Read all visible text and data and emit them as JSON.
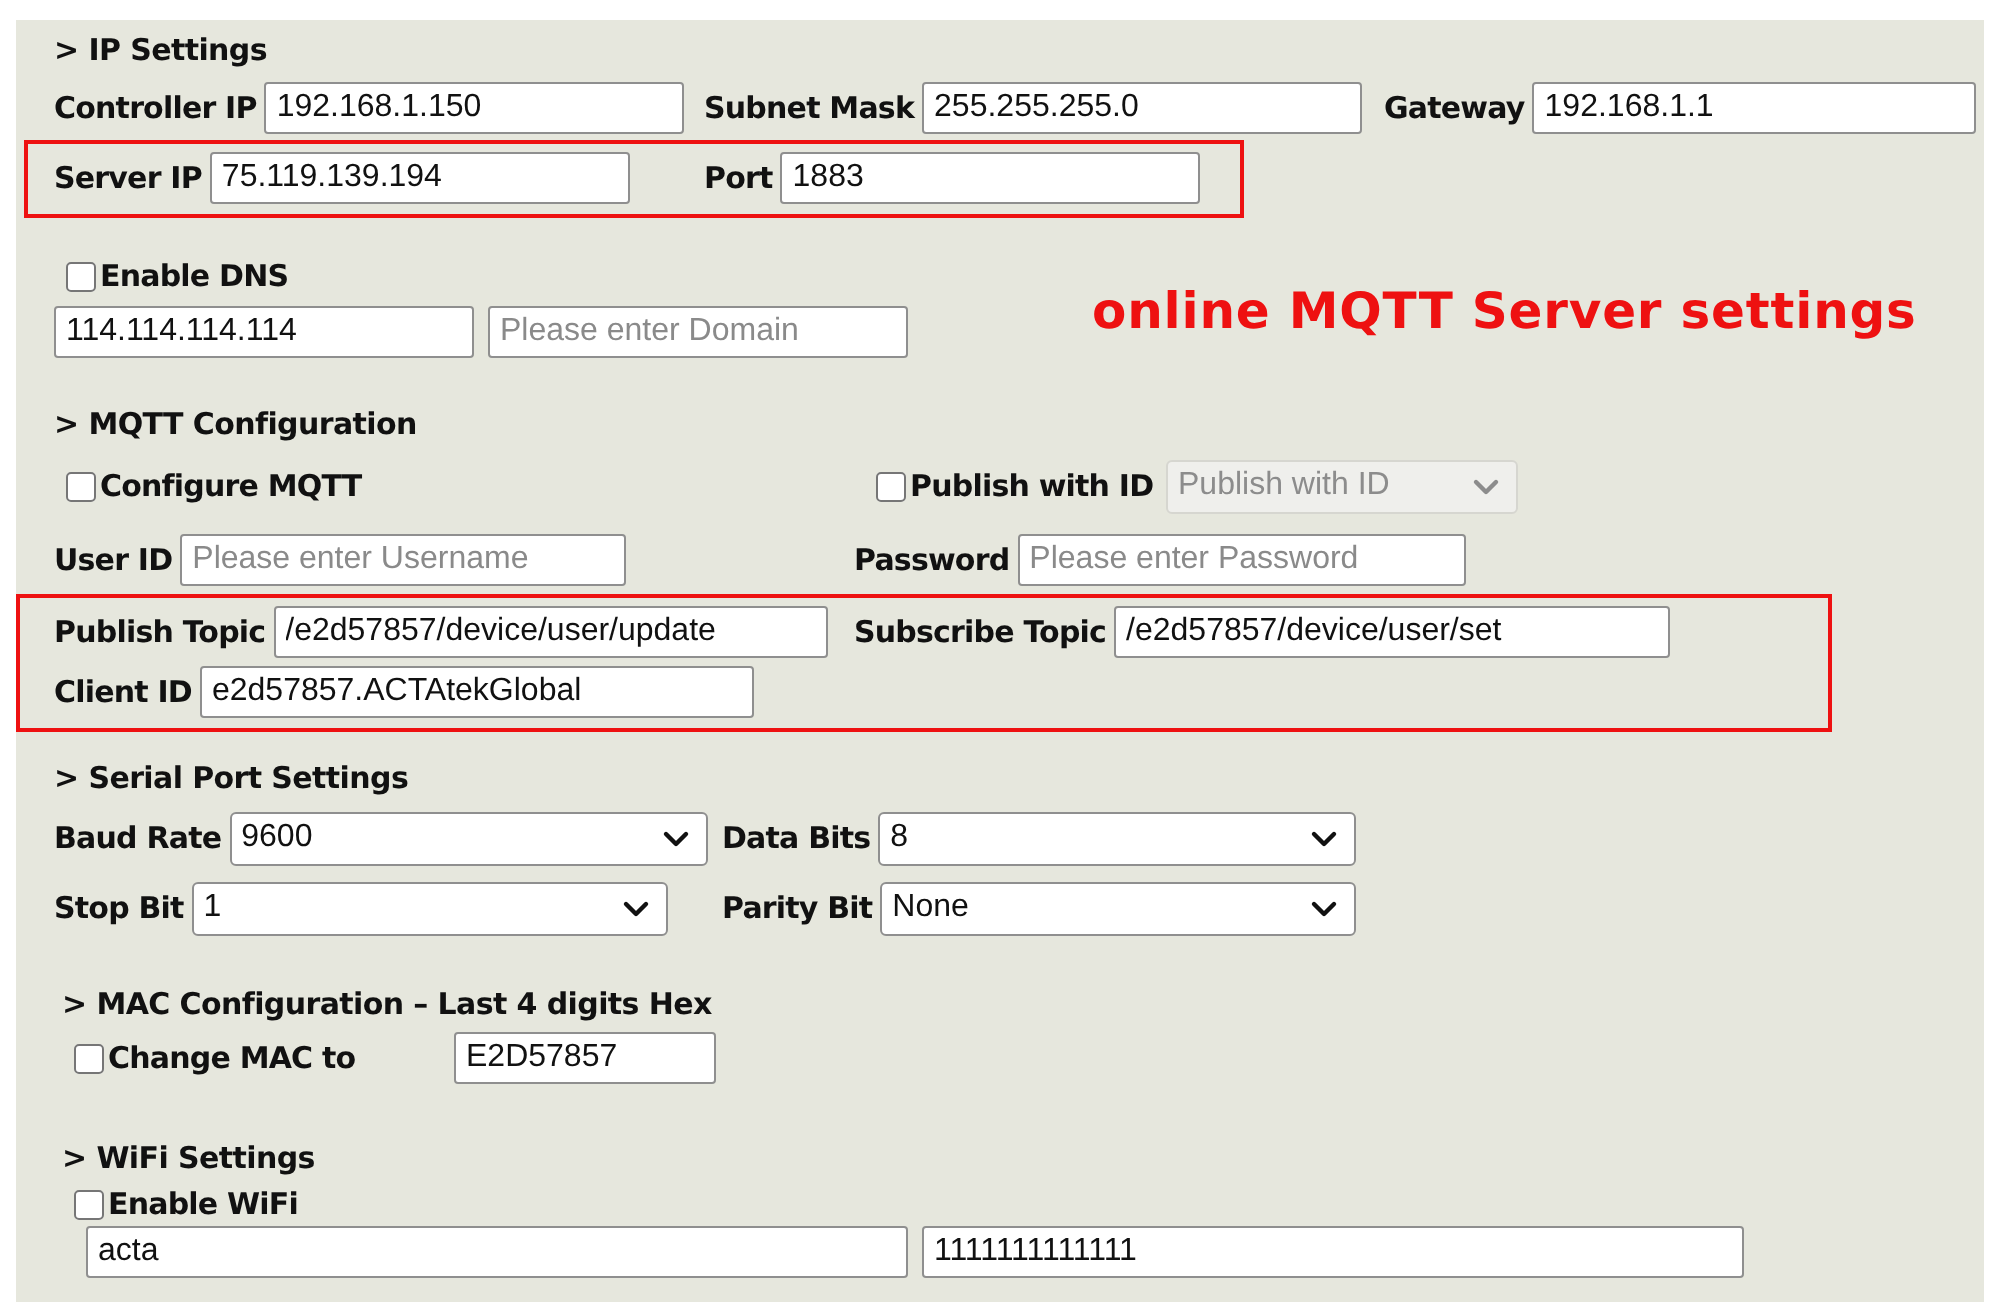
{
  "sections": [
    {
      "heading": "> IP Settings",
      "rows": [
        {
          "highlighted": false,
          "items": [
            {
              "kind": "field",
              "label": "Controller IP",
              "value": "192.168.1.150"
            },
            {
              "kind": "field",
              "label": "Subnet Mask",
              "value": "255.255.255.0"
            },
            {
              "kind": "field",
              "label": "Gateway",
              "value": "192.168.1.1"
            }
          ]
        },
        {
          "highlighted": true,
          "items": [
            {
              "kind": "field",
              "label": "Server IP",
              "value": "75.119.139.194"
            },
            {
              "kind": "field",
              "label": "Port",
              "value": "1883"
            }
          ]
        },
        {
          "highlighted": false,
          "items": [
            {
              "kind": "checkbox",
              "label": "Enable DNS",
              "checked": false
            }
          ]
        },
        {
          "highlighted": false,
          "items": [
            {
              "kind": "field",
              "value": "114.114.114.114"
            },
            {
              "kind": "field",
              "placeholder": "Please enter Domain"
            },
            {
              "kind": "note",
              "text": "online MQTT Server settings"
            }
          ]
        }
      ]
    },
    {
      "heading": "> MQTT Configuration",
      "rows": [
        {
          "highlighted": false,
          "items": [
            {
              "kind": "checkbox",
              "label": "Configure MQTT",
              "checked": false
            },
            {
              "kind": "checkbox",
              "label": "Publish with ID",
              "checked": false
            },
            {
              "kind": "select",
              "value": "Publish with ID",
              "disabled": true
            }
          ]
        },
        {
          "highlighted": false,
          "items": [
            {
              "kind": "field",
              "label": "User ID",
              "placeholder": "Please enter Username"
            },
            {
              "kind": "field",
              "label": "Password",
              "placeholder": "Please enter Password"
            }
          ]
        },
        {
          "highlighted": true,
          "items": [
            {
              "kind": "field",
              "label": "Publish Topic",
              "value": "/e2d57857/device/user/update"
            },
            {
              "kind": "field",
              "label": "Subscribe Topic",
              "value": "/e2d57857/device/user/set"
            }
          ]
        },
        {
          "highlighted": true,
          "items": [
            {
              "kind": "field",
              "label": "Client ID",
              "value": "e2d57857.ACTAtekGlobal"
            }
          ]
        }
      ]
    },
    {
      "heading": "> Serial Port Settings",
      "rows": [
        {
          "highlighted": false,
          "items": [
            {
              "kind": "select",
              "label": "Baud Rate",
              "value": "9600",
              "disabled": false
            },
            {
              "kind": "select",
              "label": "Data Bits",
              "value": "8",
              "disabled": false
            }
          ]
        },
        {
          "highlighted": false,
          "items": [
            {
              "kind": "select",
              "label": "Stop Bit",
              "value": "1",
              "disabled": false
            },
            {
              "kind": "select",
              "label": "Parity Bit",
              "value": "None",
              "disabled": false
            }
          ]
        }
      ]
    },
    {
      "heading": "> MAC Configuration – Last 4 digits Hex",
      "rows": [
        {
          "highlighted": false,
          "items": [
            {
              "kind": "checkbox",
              "label": "Change MAC to",
              "checked": false
            },
            {
              "kind": "field",
              "value": "E2D57857"
            }
          ]
        }
      ]
    },
    {
      "heading": "> WiFi Settings",
      "rows": [
        {
          "highlighted": false,
          "items": [
            {
              "kind": "checkbox",
              "label": "Enable WiFi",
              "checked": false
            }
          ]
        },
        {
          "highlighted": false,
          "items": [
            {
              "kind": "field",
              "value": "acta"
            },
            {
              "kind": "field",
              "value": "1111111111111"
            }
          ]
        }
      ]
    }
  ]
}
